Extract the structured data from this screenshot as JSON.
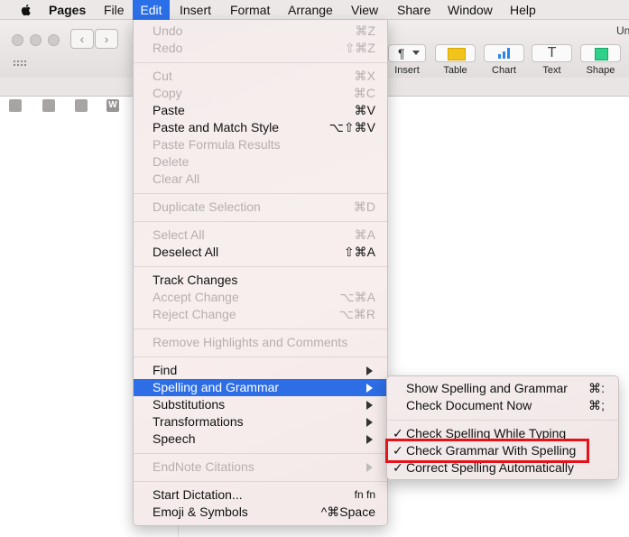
{
  "menubar": {
    "app": "Pages",
    "items": [
      "File",
      "Edit",
      "Insert",
      "Format",
      "Arrange",
      "View",
      "Share",
      "Window",
      "Help"
    ],
    "active": "Edit"
  },
  "window": {
    "title_fragment": "Un",
    "toolbar": {
      "insert_glyph": "¶",
      "insert_label": "Insert",
      "table_label": "Table",
      "chart_label": "Chart",
      "text_glyph": "T",
      "text_label": "Text",
      "shape_label": "Shape"
    },
    "bookmark_w_label": "W"
  },
  "edit_menu": {
    "undo": {
      "label": "Undo",
      "shortcut": "⌘Z"
    },
    "redo": {
      "label": "Redo",
      "shortcut": "⇧⌘Z"
    },
    "cut": {
      "label": "Cut",
      "shortcut": "⌘X"
    },
    "copy": {
      "label": "Copy",
      "shortcut": "⌘C"
    },
    "paste": {
      "label": "Paste",
      "shortcut": "⌘V"
    },
    "paste_match": {
      "label": "Paste and Match Style",
      "shortcut": "⌥⇧⌘V"
    },
    "paste_formula": {
      "label": "Paste Formula Results"
    },
    "delete": {
      "label": "Delete"
    },
    "clear_all": {
      "label": "Clear All"
    },
    "duplicate": {
      "label": "Duplicate Selection",
      "shortcut": "⌘D"
    },
    "select_all": {
      "label": "Select All",
      "shortcut": "⌘A"
    },
    "deselect_all": {
      "label": "Deselect All",
      "shortcut": "⇧⌘A"
    },
    "track_changes": {
      "label": "Track Changes"
    },
    "accept_change": {
      "label": "Accept Change",
      "shortcut": "⌥⌘A"
    },
    "reject_change": {
      "label": "Reject Change",
      "shortcut": "⌥⌘R"
    },
    "remove_highlights": {
      "label": "Remove Highlights and Comments"
    },
    "find": {
      "label": "Find"
    },
    "spelling": {
      "label": "Spelling and Grammar"
    },
    "substitutions": {
      "label": "Substitutions"
    },
    "transformations": {
      "label": "Transformations"
    },
    "speech": {
      "label": "Speech"
    },
    "endnote": {
      "label": "EndNote Citations"
    },
    "dictation": {
      "label": "Start Dictation...",
      "shortcut": "fn fn"
    },
    "emoji": {
      "label": "Emoji & Symbols",
      "shortcut": "^⌘Space"
    }
  },
  "spelling_submenu": {
    "show": {
      "label": "Show Spelling and Grammar",
      "shortcut": "⌘:"
    },
    "check_now": {
      "label": "Check Document Now",
      "shortcut": "⌘;"
    },
    "check_typing": {
      "label": "Check Spelling While Typing",
      "checked": true
    },
    "check_grammar": {
      "label": "Check Grammar With Spelling",
      "checked": true
    },
    "correct_auto": {
      "label": "Correct Spelling Automatically",
      "checked": true
    },
    "check_mark": "✓"
  },
  "colors": {
    "selection": "#2d6ee6",
    "callout": "#e4131a",
    "disabled_text": "#b7afaf"
  }
}
